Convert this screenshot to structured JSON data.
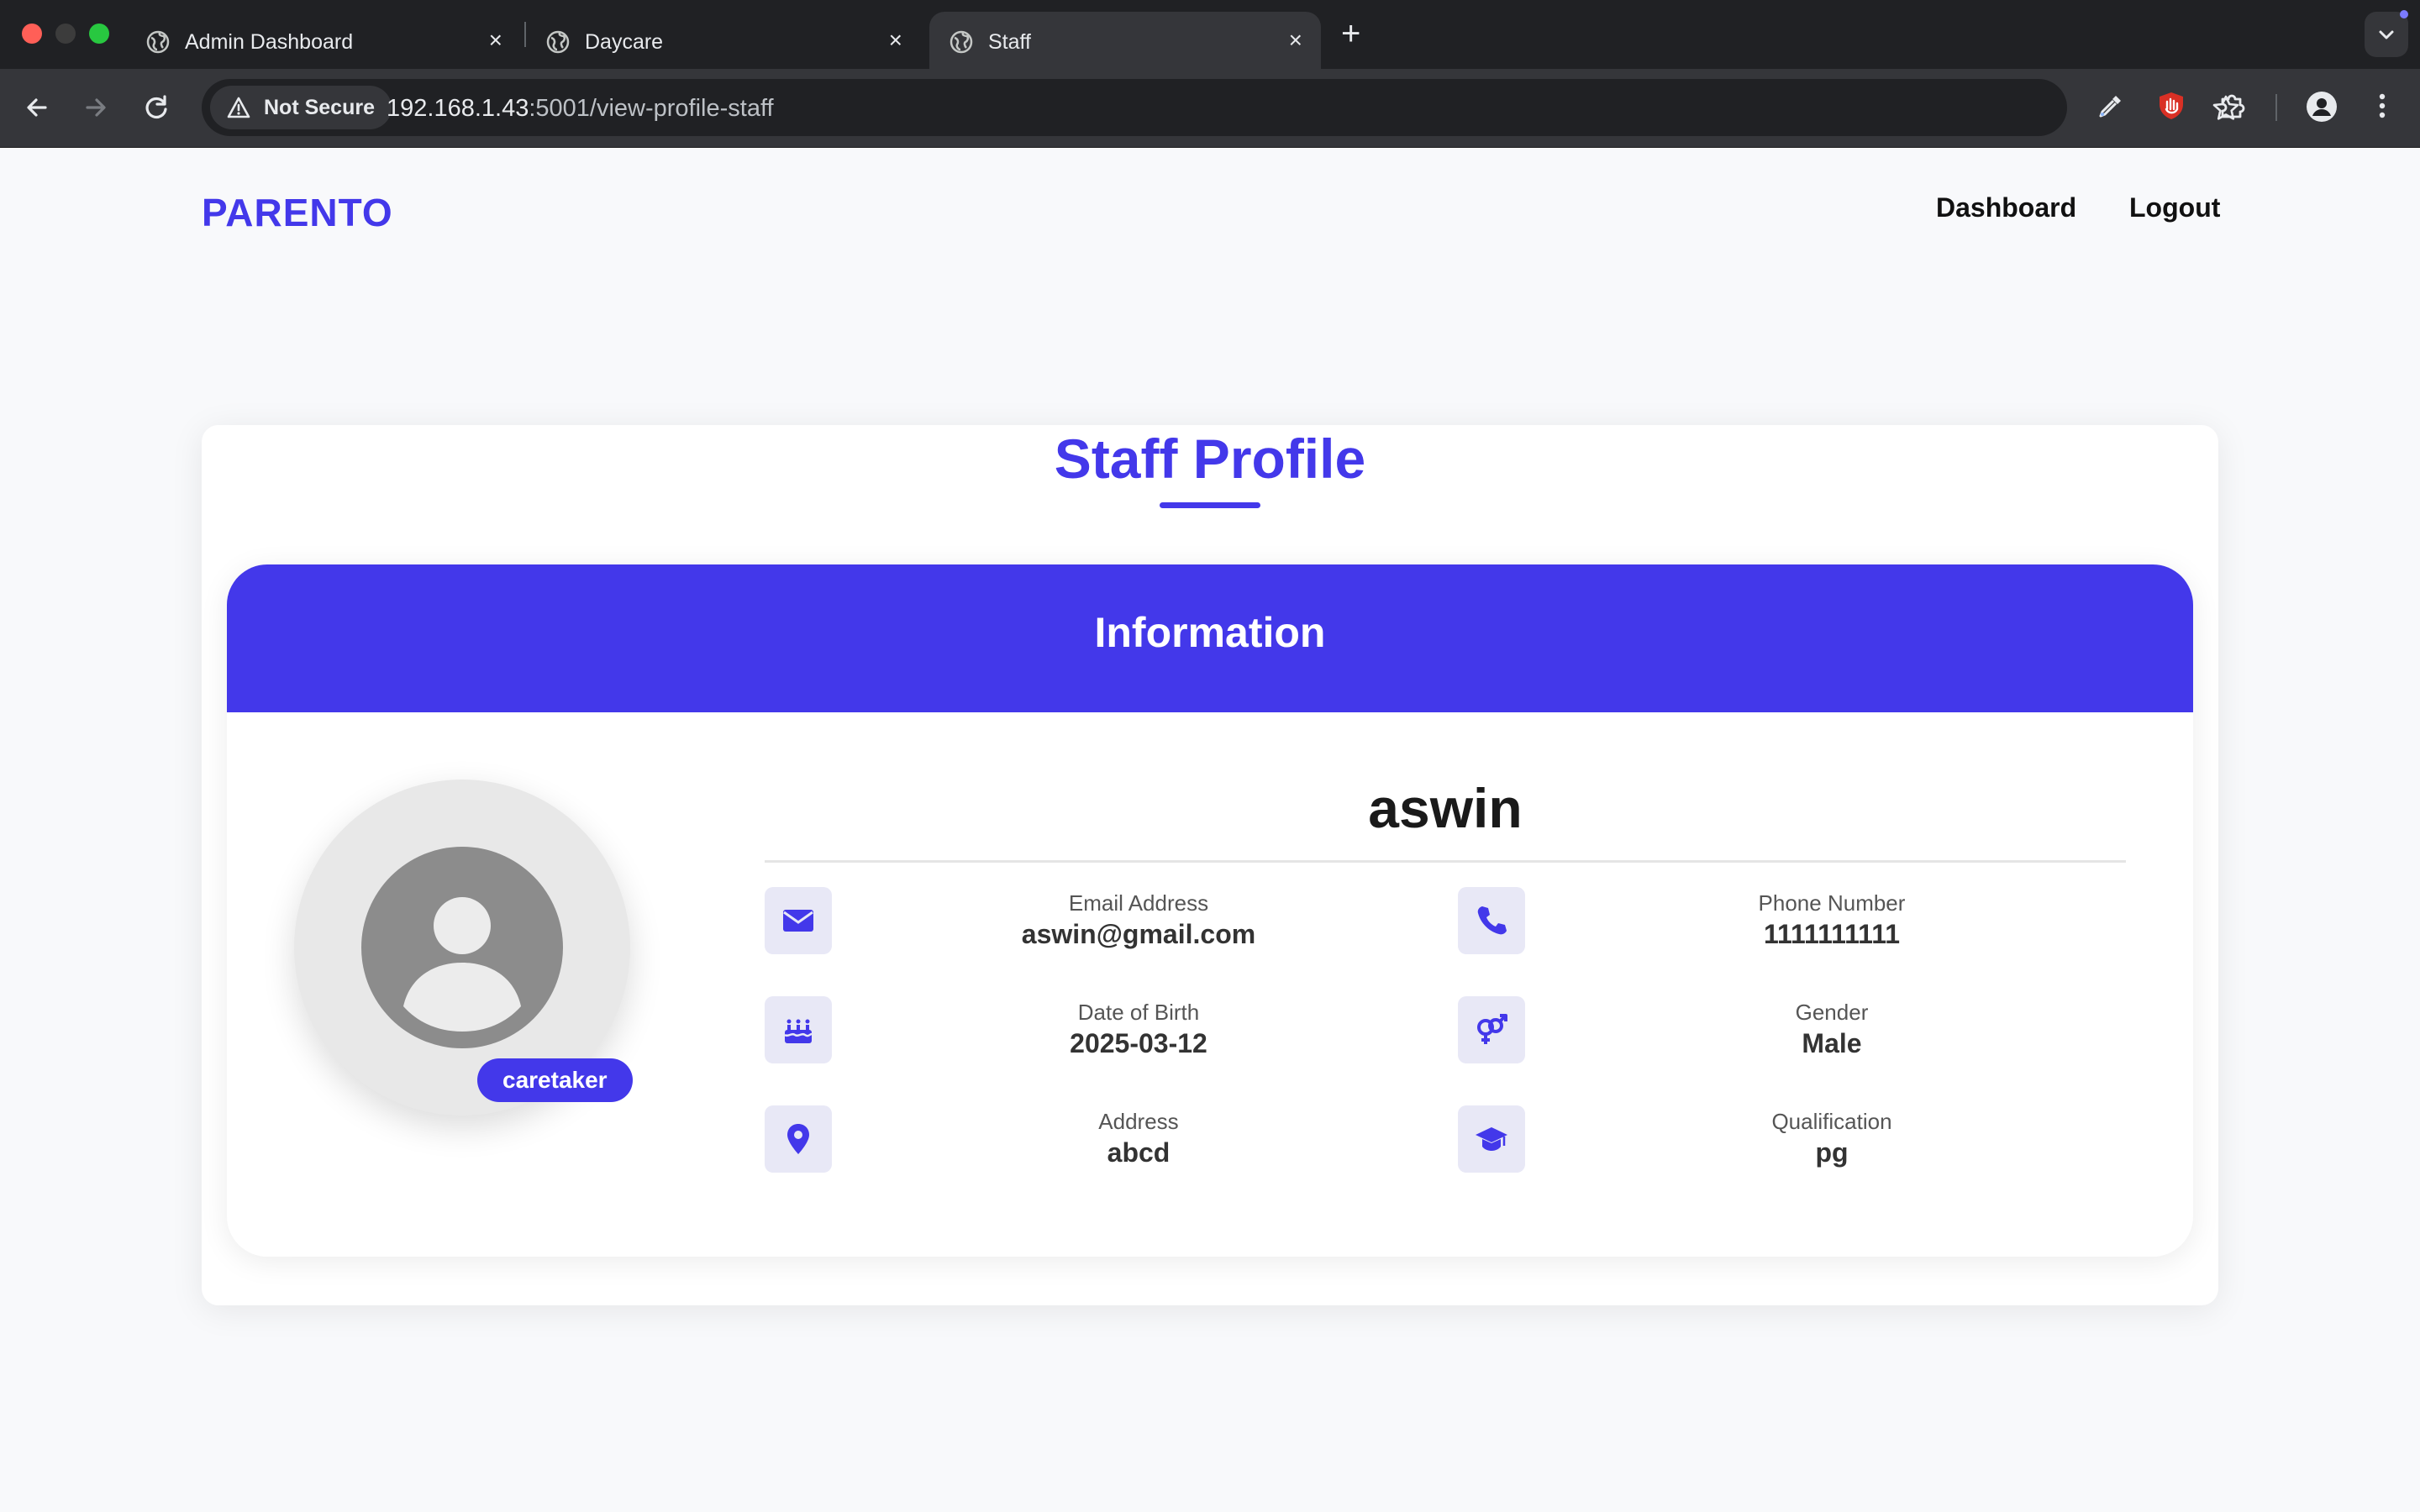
{
  "browser": {
    "tabs": [
      {
        "title": "Admin Dashboard",
        "active": false
      },
      {
        "title": "Daycare",
        "active": false
      },
      {
        "title": "Staff",
        "active": true
      }
    ],
    "security_label": "Not Secure",
    "url_host": "192.168.1.43",
    "url_rest": ":5001/view-profile-staff"
  },
  "header": {
    "brand": "PARENTO",
    "nav": [
      "Dashboard",
      "Logout"
    ]
  },
  "profile": {
    "title": "Staff Profile",
    "section_title": "Information",
    "name": "aswin",
    "role": "caretaker",
    "fields": {
      "email": {
        "label": "Email Address",
        "value": "aswin@gmail.com",
        "icon": "envelope-icon"
      },
      "phone": {
        "label": "Phone Number",
        "value": "1111111111",
        "icon": "phone-icon"
      },
      "dob": {
        "label": "Date of Birth",
        "value": "2025-03-12",
        "icon": "birthday-cake-icon"
      },
      "gender": {
        "label": "Gender",
        "value": "Male",
        "icon": "gender-icon"
      },
      "address": {
        "label": "Address",
        "value": "abcd",
        "icon": "map-marker-icon"
      },
      "qualification": {
        "label": "Qualification",
        "value": "pg",
        "icon": "graduation-cap-icon"
      }
    }
  },
  "colors": {
    "brand": "#4338ea",
    "chrome_dark": "#202124",
    "page_bg": "#f8f9fb"
  }
}
